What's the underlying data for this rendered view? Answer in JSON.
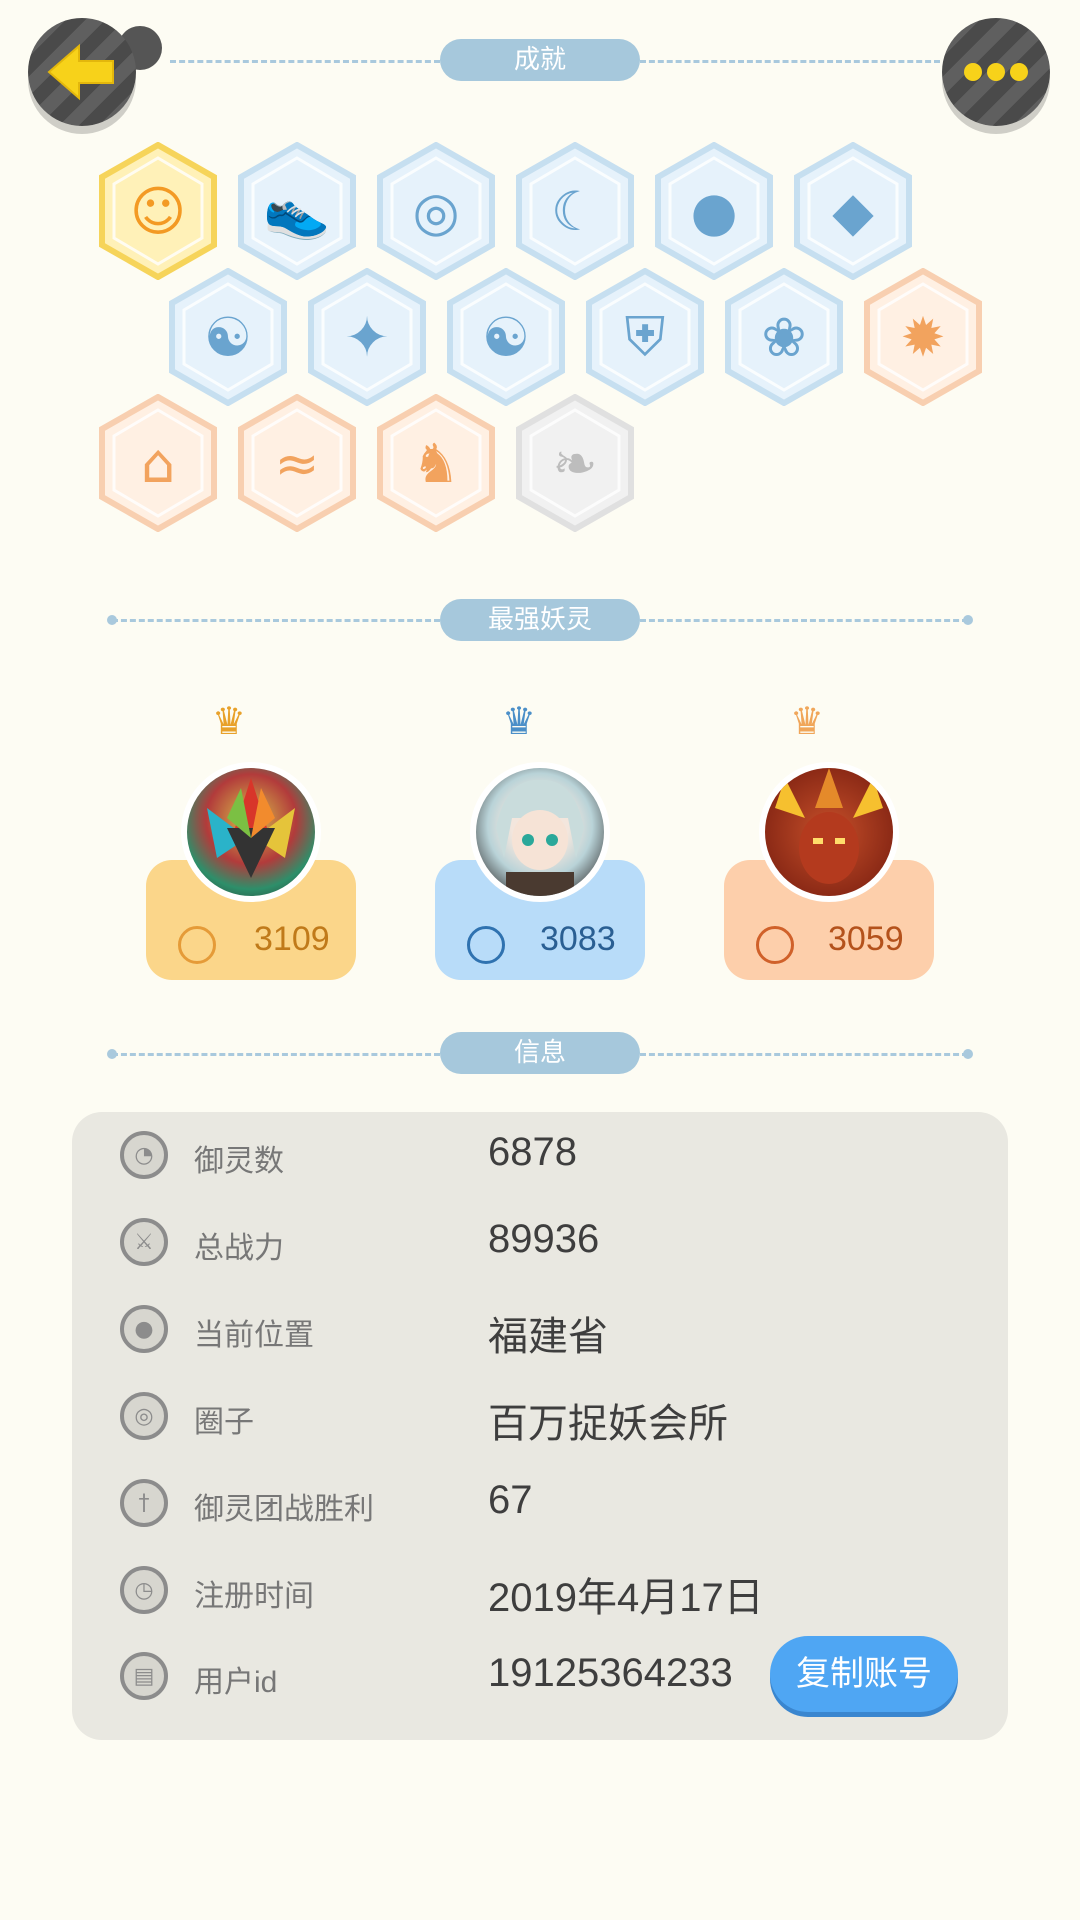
{
  "header": {
    "back_label": "back",
    "more_label": "more"
  },
  "sections": {
    "achievements_title": "成就",
    "strongest_title": "最强妖灵",
    "info_title": "信息"
  },
  "achievements": [
    {
      "icon": "orange-cat-face-icon",
      "tone": "gold"
    },
    {
      "icon": "sneaker-icon",
      "tone": "blue"
    },
    {
      "icon": "target-signpost-icon",
      "tone": "blue"
    },
    {
      "icon": "moon-planet-icon",
      "tone": "blue"
    },
    {
      "icon": "crystal-ball-icon",
      "tone": "blue"
    },
    {
      "icon": "gem-crystal-icon",
      "tone": "blue"
    },
    {
      "icon": "yin-yang-wave-icon",
      "tone": "blue"
    },
    {
      "icon": "dancing-cat-icon",
      "tone": "blue"
    },
    {
      "icon": "yin-yang-card-icon",
      "tone": "blue"
    },
    {
      "icon": "shield-scroll-icon",
      "tone": "blue"
    },
    {
      "icon": "cat-friends-icon",
      "tone": "blue"
    },
    {
      "icon": "fire-spirit-icon",
      "tone": "orange"
    },
    {
      "icon": "cat-stroller-icon",
      "tone": "orange"
    },
    {
      "icon": "koi-fish-icon",
      "tone": "orange"
    },
    {
      "icon": "horned-monster-icon",
      "tone": "orange"
    },
    {
      "icon": "wolf-book-icon",
      "tone": "grey"
    }
  ],
  "monsters": [
    {
      "name": "monster-1",
      "power": "3109",
      "tone": "gold",
      "crown": "gold"
    },
    {
      "name": "monster-2",
      "power": "3083",
      "tone": "blue",
      "crown": "blue"
    },
    {
      "name": "monster-3",
      "power": "3059",
      "tone": "orange",
      "crown": "orange"
    }
  ],
  "info": {
    "rows": [
      {
        "icon": "cat-head-icon",
        "label": "御灵数",
        "value": "6878"
      },
      {
        "icon": "sword-icon",
        "label": "总战力",
        "value": "89936"
      },
      {
        "icon": "location-pin-icon",
        "label": "当前位置",
        "value": "福建省"
      },
      {
        "icon": "circle-target-icon",
        "label": "圈子",
        "value": "百万捉妖会所"
      },
      {
        "icon": "dagger-icon",
        "label": "御灵团战胜利",
        "value": "67"
      },
      {
        "icon": "clock-icon",
        "label": "注册时间",
        "value": "2019年4月17日"
      },
      {
        "icon": "id-card-icon",
        "label": "用户id",
        "value": "19125364233"
      }
    ],
    "copy_button": "复制账号"
  },
  "colors": {
    "background": "#fdfcf3",
    "section_pill": "#a6c8dc",
    "gold_card": "#fbd68a",
    "blue_card": "#b8dcf9",
    "orange_card": "#fdcfab",
    "copy_button": "#4fa6f3"
  }
}
